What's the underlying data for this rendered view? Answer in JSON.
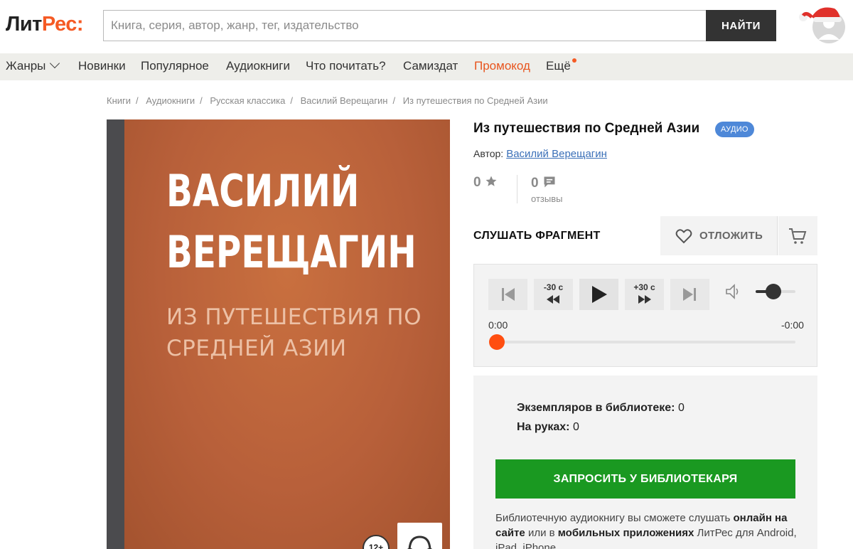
{
  "header": {
    "logo_main": "Лит",
    "logo_accent": "Рес",
    "logo_colon": ":",
    "search_placeholder": "Книга, серия, автор, жанр, тег, издательство",
    "search_button": "НАЙТИ"
  },
  "nav": {
    "items": [
      {
        "label": "Жанры"
      },
      {
        "label": "Новинки"
      },
      {
        "label": "Популярное"
      },
      {
        "label": "Аудиокниги"
      },
      {
        "label": "Что почитать?"
      },
      {
        "label": "Самиздат"
      },
      {
        "label": "Промокод"
      },
      {
        "label": "Ещё"
      }
    ],
    "promo_color": "#e8551e"
  },
  "breadcrumb": [
    "Книги",
    "Аудиокниги",
    "Русская классика",
    "Василий Верещагин",
    "Из путешествия по Средней Азии"
  ],
  "cover": {
    "author_line1": "ВАСИЛИЙ",
    "author_line2": "ВЕРЕЩАГИН",
    "title_line1": "ИЗ ПУТЕШЕСТВИЯ ПО",
    "title_line2": "СРЕДНЕЙ АЗИИ",
    "age_rating": "12+",
    "cover_color": "#b75d36"
  },
  "book": {
    "title": "Из путешествия по Средней Азии",
    "format_badge": "АУДИО",
    "author_label": "Автор:",
    "author_name": "Василий Верещагин",
    "rating": "0",
    "reviews_count": "0",
    "reviews_label": "отзывы"
  },
  "actions": {
    "listen_fragment": "СЛУШАТЬ ФРАГМЕНТ",
    "postpone": "ОТЛОЖИТЬ"
  },
  "player": {
    "back30": "-30 с",
    "forward30": "+30 с",
    "time_elapsed": "0:00",
    "time_remaining": "-0:00",
    "volume_level": 0.45,
    "progress": 0
  },
  "library": {
    "copies_label": "Экземпляров в библиотеке:",
    "copies_value": "0",
    "on_hands_label": "На руках:",
    "on_hands_value": "0",
    "request_button": "ЗАПРОСИТЬ У БИБЛИОТЕКАРЯ",
    "note_part1": "Библиотечную аудиокнигу вы сможете слушать ",
    "note_bold1": "онлайн на сайте",
    "note_part2": " или в ",
    "note_bold2": "мобильных приложениях",
    "note_part3": " ЛитРес для Android, iPad, iPhone"
  }
}
